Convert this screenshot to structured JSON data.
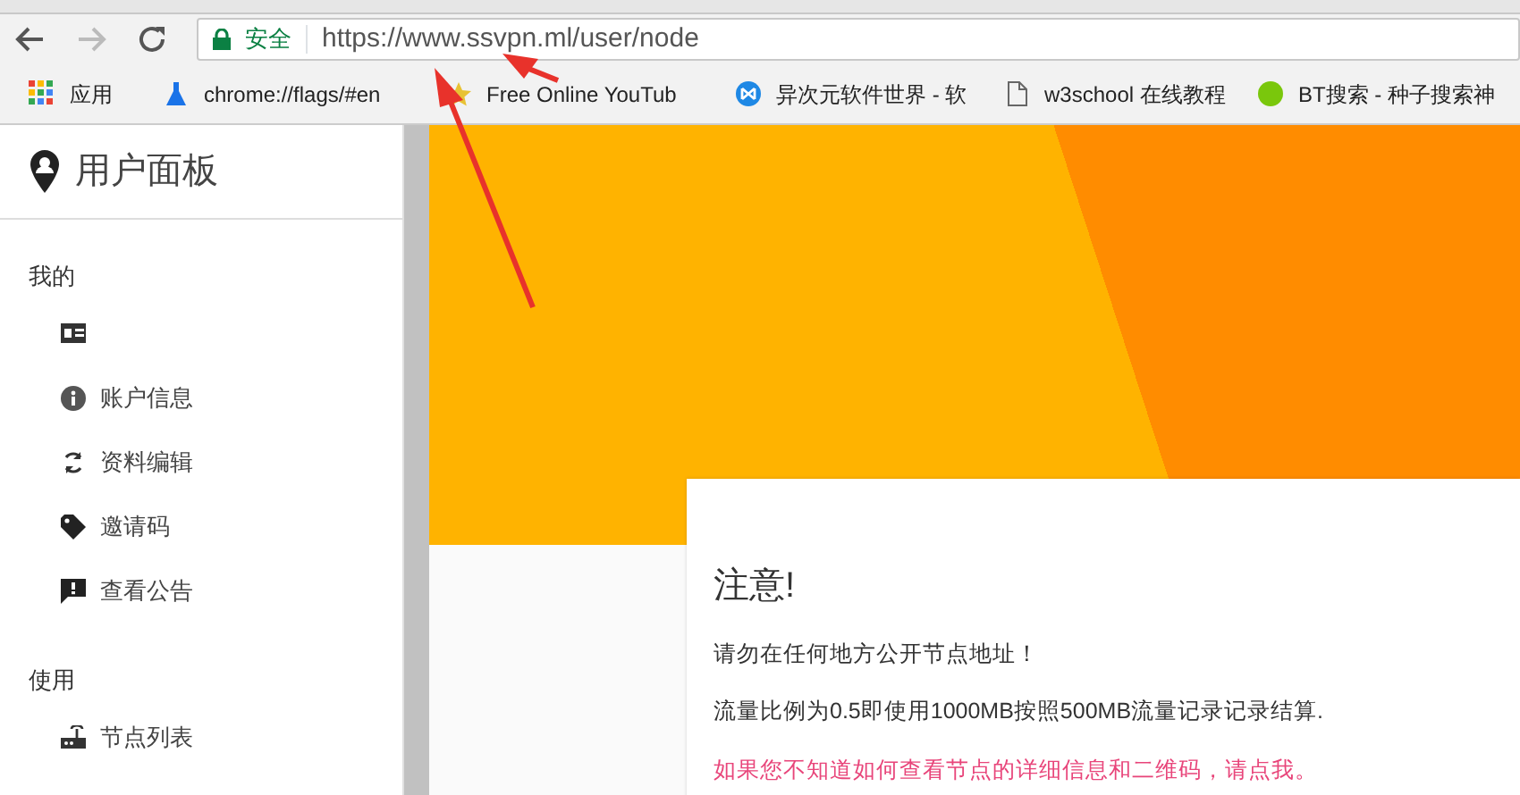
{
  "browser": {
    "security_label": "安全",
    "url": "https://www.ssvpn.ml/user/node",
    "bookmarks": [
      {
        "label": "应用"
      },
      {
        "label": "chrome://flags/#en"
      },
      {
        "label": "Free Online YouTub"
      },
      {
        "label": "异次元软件世界 - 软"
      },
      {
        "label": "w3school 在线教程"
      },
      {
        "label": "BT搜索 - 种子搜索神"
      }
    ]
  },
  "sidebar": {
    "title": "用户面板",
    "sections": [
      {
        "heading": "我的",
        "items": [
          {
            "kind": "covered"
          },
          {
            "kind": "link",
            "label": "账户信息"
          },
          {
            "kind": "link",
            "label": "资料编辑"
          },
          {
            "kind": "link",
            "label": "邀请码"
          },
          {
            "kind": "link",
            "label": "查看公告"
          }
        ]
      },
      {
        "heading": "使用",
        "items": [
          {
            "kind": "link",
            "label": "节点列表"
          }
        ]
      }
    ]
  },
  "notice": {
    "heading": "注意!",
    "lines": [
      "请勿在任何地方公开节点地址！",
      "流量比例为0.5即使用1000MB按照500MB流量记录记录结算."
    ],
    "help_link": "如果您不知道如何查看节点的详细信息和二维码，请点我。"
  }
}
